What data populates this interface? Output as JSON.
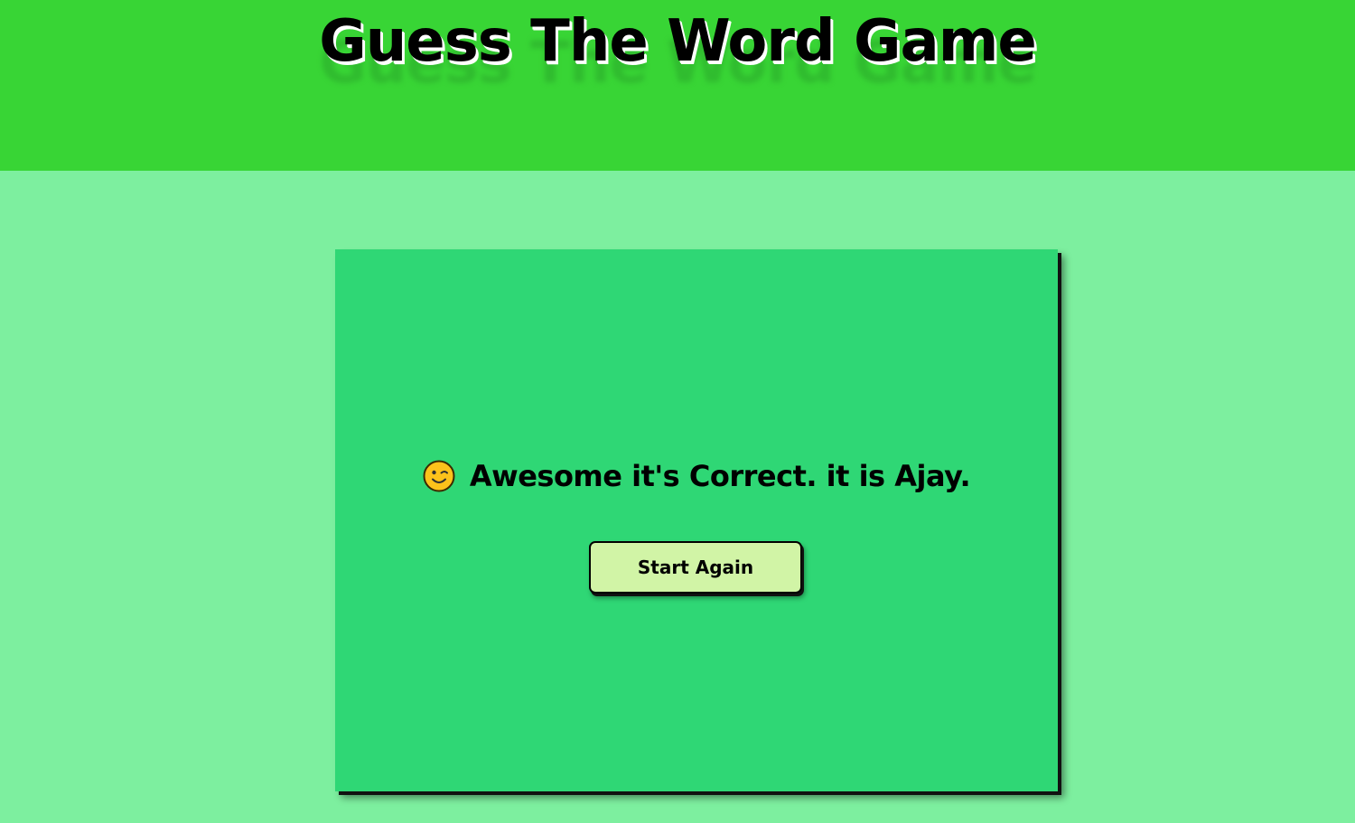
{
  "header": {
    "title": "Guess The Word Game"
  },
  "colors": {
    "header_bg": "#38d535",
    "page_bg": "#7def9f",
    "card_bg": "#2fd775",
    "button_bg": "#d1f4a6"
  },
  "game": {
    "result_icon": "winking-face-icon",
    "result_message": "Awesome it's Correct. it is Ajay.",
    "start_again_label": "Start Again"
  }
}
